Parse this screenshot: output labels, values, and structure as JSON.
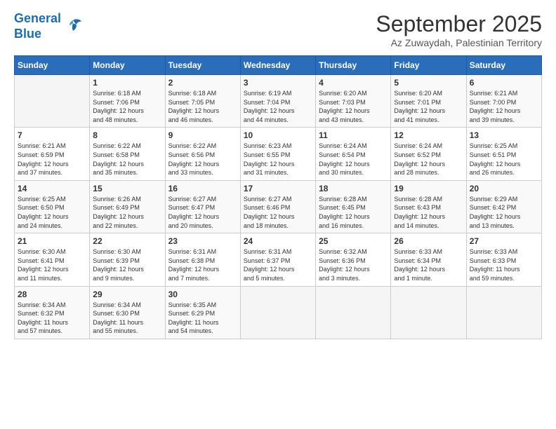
{
  "header": {
    "logo_line1": "General",
    "logo_line2": "Blue",
    "month": "September 2025",
    "location": "Az Zuwaydah, Palestinian Territory"
  },
  "weekdays": [
    "Sunday",
    "Monday",
    "Tuesday",
    "Wednesday",
    "Thursday",
    "Friday",
    "Saturday"
  ],
  "weeks": [
    [
      {
        "day": "",
        "info": ""
      },
      {
        "day": "1",
        "info": "Sunrise: 6:18 AM\nSunset: 7:06 PM\nDaylight: 12 hours\nand 48 minutes."
      },
      {
        "day": "2",
        "info": "Sunrise: 6:18 AM\nSunset: 7:05 PM\nDaylight: 12 hours\nand 46 minutes."
      },
      {
        "day": "3",
        "info": "Sunrise: 6:19 AM\nSunset: 7:04 PM\nDaylight: 12 hours\nand 44 minutes."
      },
      {
        "day": "4",
        "info": "Sunrise: 6:20 AM\nSunset: 7:03 PM\nDaylight: 12 hours\nand 43 minutes."
      },
      {
        "day": "5",
        "info": "Sunrise: 6:20 AM\nSunset: 7:01 PM\nDaylight: 12 hours\nand 41 minutes."
      },
      {
        "day": "6",
        "info": "Sunrise: 6:21 AM\nSunset: 7:00 PM\nDaylight: 12 hours\nand 39 minutes."
      }
    ],
    [
      {
        "day": "7",
        "info": "Sunrise: 6:21 AM\nSunset: 6:59 PM\nDaylight: 12 hours\nand 37 minutes."
      },
      {
        "day": "8",
        "info": "Sunrise: 6:22 AM\nSunset: 6:58 PM\nDaylight: 12 hours\nand 35 minutes."
      },
      {
        "day": "9",
        "info": "Sunrise: 6:22 AM\nSunset: 6:56 PM\nDaylight: 12 hours\nand 33 minutes."
      },
      {
        "day": "10",
        "info": "Sunrise: 6:23 AM\nSunset: 6:55 PM\nDaylight: 12 hours\nand 31 minutes."
      },
      {
        "day": "11",
        "info": "Sunrise: 6:24 AM\nSunset: 6:54 PM\nDaylight: 12 hours\nand 30 minutes."
      },
      {
        "day": "12",
        "info": "Sunrise: 6:24 AM\nSunset: 6:52 PM\nDaylight: 12 hours\nand 28 minutes."
      },
      {
        "day": "13",
        "info": "Sunrise: 6:25 AM\nSunset: 6:51 PM\nDaylight: 12 hours\nand 26 minutes."
      }
    ],
    [
      {
        "day": "14",
        "info": "Sunrise: 6:25 AM\nSunset: 6:50 PM\nDaylight: 12 hours\nand 24 minutes."
      },
      {
        "day": "15",
        "info": "Sunrise: 6:26 AM\nSunset: 6:49 PM\nDaylight: 12 hours\nand 22 minutes."
      },
      {
        "day": "16",
        "info": "Sunrise: 6:27 AM\nSunset: 6:47 PM\nDaylight: 12 hours\nand 20 minutes."
      },
      {
        "day": "17",
        "info": "Sunrise: 6:27 AM\nSunset: 6:46 PM\nDaylight: 12 hours\nand 18 minutes."
      },
      {
        "day": "18",
        "info": "Sunrise: 6:28 AM\nSunset: 6:45 PM\nDaylight: 12 hours\nand 16 minutes."
      },
      {
        "day": "19",
        "info": "Sunrise: 6:28 AM\nSunset: 6:43 PM\nDaylight: 12 hours\nand 14 minutes."
      },
      {
        "day": "20",
        "info": "Sunrise: 6:29 AM\nSunset: 6:42 PM\nDaylight: 12 hours\nand 13 minutes."
      }
    ],
    [
      {
        "day": "21",
        "info": "Sunrise: 6:30 AM\nSunset: 6:41 PM\nDaylight: 12 hours\nand 11 minutes."
      },
      {
        "day": "22",
        "info": "Sunrise: 6:30 AM\nSunset: 6:39 PM\nDaylight: 12 hours\nand 9 minutes."
      },
      {
        "day": "23",
        "info": "Sunrise: 6:31 AM\nSunset: 6:38 PM\nDaylight: 12 hours\nand 7 minutes."
      },
      {
        "day": "24",
        "info": "Sunrise: 6:31 AM\nSunset: 6:37 PM\nDaylight: 12 hours\nand 5 minutes."
      },
      {
        "day": "25",
        "info": "Sunrise: 6:32 AM\nSunset: 6:36 PM\nDaylight: 12 hours\nand 3 minutes."
      },
      {
        "day": "26",
        "info": "Sunrise: 6:33 AM\nSunset: 6:34 PM\nDaylight: 12 hours\nand 1 minute."
      },
      {
        "day": "27",
        "info": "Sunrise: 6:33 AM\nSunset: 6:33 PM\nDaylight: 11 hours\nand 59 minutes."
      }
    ],
    [
      {
        "day": "28",
        "info": "Sunrise: 6:34 AM\nSunset: 6:32 PM\nDaylight: 11 hours\nand 57 minutes."
      },
      {
        "day": "29",
        "info": "Sunrise: 6:34 AM\nSunset: 6:30 PM\nDaylight: 11 hours\nand 55 minutes."
      },
      {
        "day": "30",
        "info": "Sunrise: 6:35 AM\nSunset: 6:29 PM\nDaylight: 11 hours\nand 54 minutes."
      },
      {
        "day": "",
        "info": ""
      },
      {
        "day": "",
        "info": ""
      },
      {
        "day": "",
        "info": ""
      },
      {
        "day": "",
        "info": ""
      }
    ]
  ]
}
